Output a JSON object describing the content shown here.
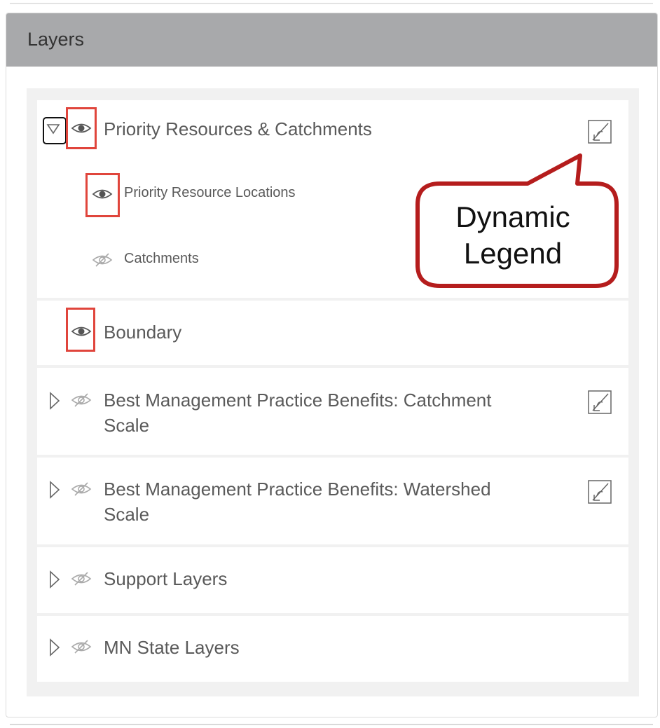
{
  "panel": {
    "title": "Layers"
  },
  "layers": {
    "priority": {
      "label": "Priority Resources & Catchments",
      "expanded": true,
      "visible": true
    },
    "priority_locations": {
      "label": "Priority Resource Locations",
      "visible": true
    },
    "catchments": {
      "label": "Catchments",
      "visible": false
    },
    "boundary": {
      "label": "Boundary",
      "visible": true
    },
    "bmp_catchment": {
      "label_line1": "Best Management Practice Benefits: Catchment",
      "label_line2": "Scale",
      "visible": false
    },
    "bmp_watershed": {
      "label_line1": "Best Management Practice Benefits: Watershed",
      "label_line2": "Scale",
      "visible": false
    },
    "support": {
      "label": "Support Layers",
      "visible": false
    },
    "mn_state": {
      "label": "MN State Layers",
      "visible": false
    }
  },
  "callout": {
    "line1": "Dynamic",
    "line2": "Legend"
  },
  "colors": {
    "highlight": "#e0453c",
    "callout_border": "#b51d1d",
    "header": "#a8a9ab"
  }
}
